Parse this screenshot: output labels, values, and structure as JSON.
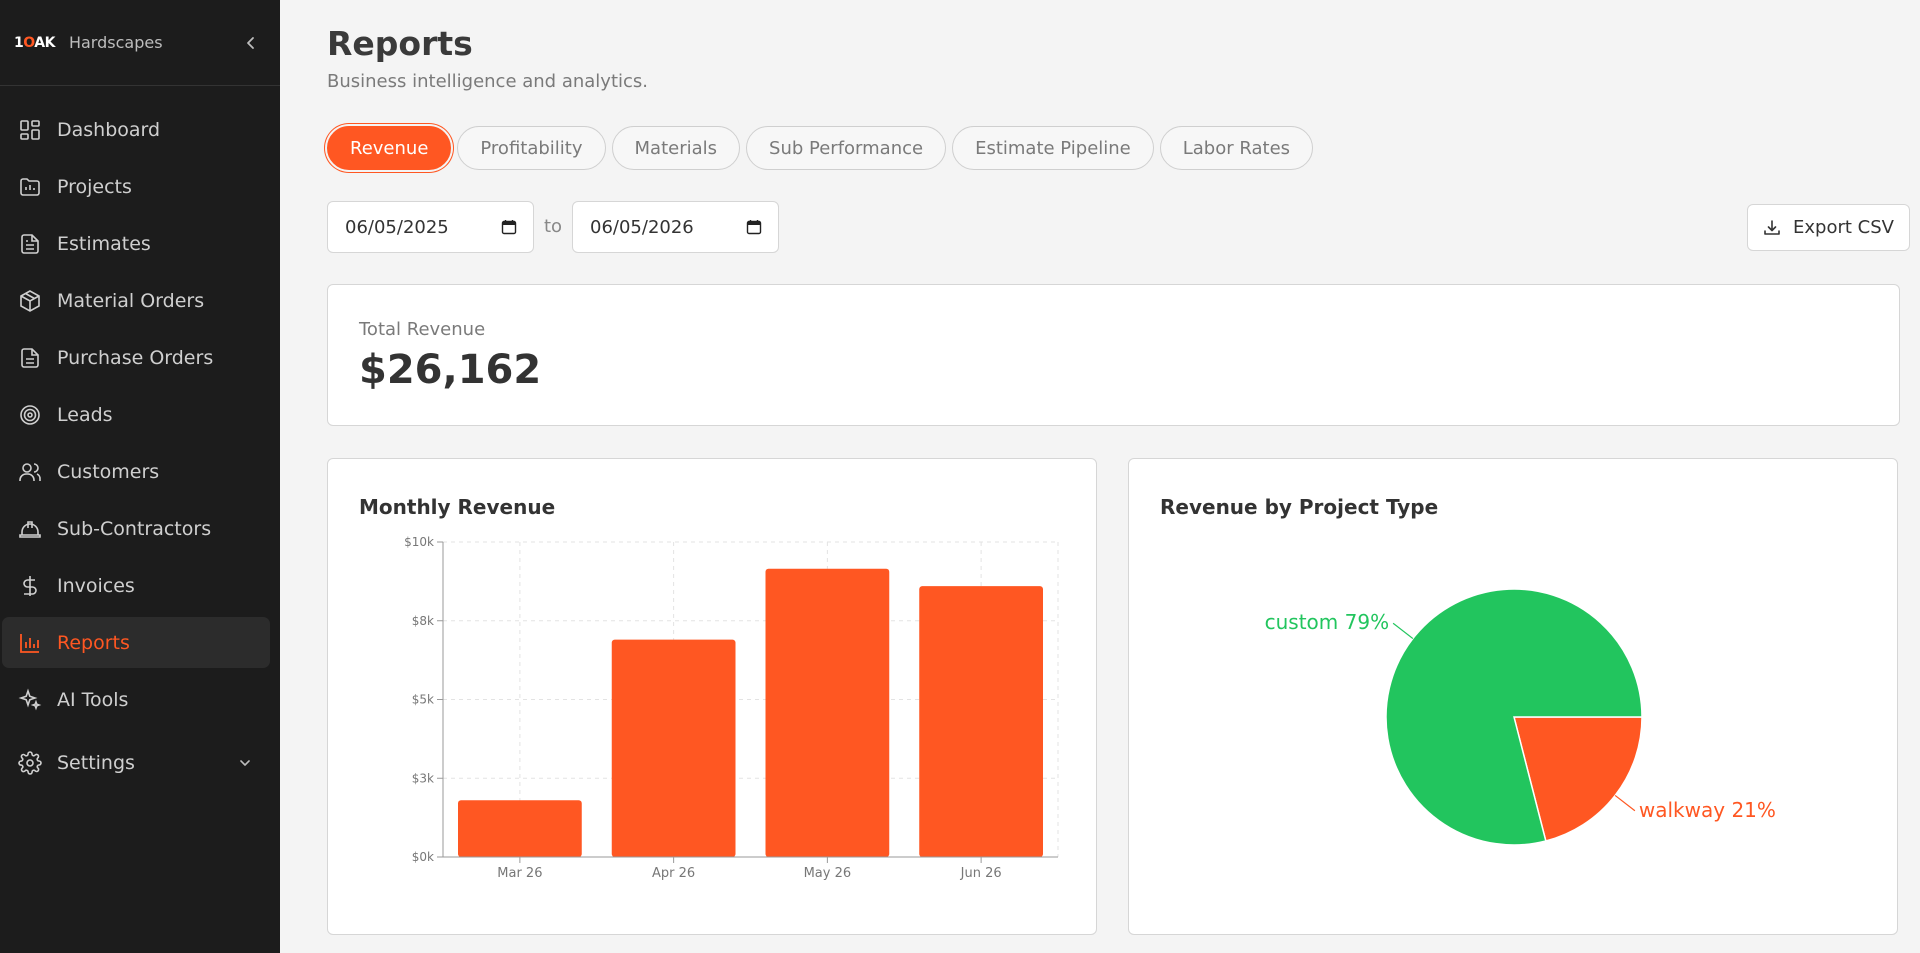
{
  "brand": {
    "logo_prefix": "1",
    "logo_o": "O",
    "logo_suffix": "AK",
    "name": "Hardscapes"
  },
  "sidebar": {
    "items": [
      {
        "label": "Dashboard",
        "icon": "dashboard-icon",
        "active": false
      },
      {
        "label": "Projects",
        "icon": "projects-icon",
        "active": false
      },
      {
        "label": "Estimates",
        "icon": "estimates-icon",
        "active": false
      },
      {
        "label": "Material Orders",
        "icon": "package-icon",
        "active": false
      },
      {
        "label": "Purchase Orders",
        "icon": "document-icon",
        "active": false
      },
      {
        "label": "Leads",
        "icon": "target-icon",
        "active": false
      },
      {
        "label": "Customers",
        "icon": "users-icon",
        "active": false
      },
      {
        "label": "Sub-Contractors",
        "icon": "hard-hat-icon",
        "active": false
      },
      {
        "label": "Invoices",
        "icon": "dollar-icon",
        "active": false
      },
      {
        "label": "Reports",
        "icon": "bar-chart-icon",
        "active": true
      },
      {
        "label": "AI Tools",
        "icon": "sparkles-icon",
        "active": false
      }
    ],
    "settings_label": "Settings"
  },
  "page": {
    "title": "Reports",
    "subtitle": "Business intelligence and analytics."
  },
  "tabs": [
    {
      "label": "Revenue",
      "active": true
    },
    {
      "label": "Profitability",
      "active": false
    },
    {
      "label": "Materials",
      "active": false
    },
    {
      "label": "Sub Performance",
      "active": false
    },
    {
      "label": "Estimate Pipeline",
      "active": false
    },
    {
      "label": "Labor Rates",
      "active": false
    }
  ],
  "filters": {
    "start_date": "06/05/2025",
    "to_label": "to",
    "end_date": "06/05/2026",
    "export_label": "Export CSV"
  },
  "summary": {
    "total_label": "Total Revenue",
    "total_value": "$26,162"
  },
  "colors": {
    "accent": "#ff5722",
    "green": "#22c55e",
    "sidebar_bg": "#1c1c1c"
  },
  "chart_data": [
    {
      "type": "bar",
      "title": "Monthly Revenue",
      "categories": [
        "Mar 26",
        "Apr 26",
        "May 26",
        "Jun 26"
      ],
      "values": [
        1800,
        6900,
        9150,
        8600
      ],
      "ylim": [
        0,
        10000
      ],
      "yticks": [
        0,
        2500,
        5000,
        7500,
        10000
      ],
      "ytick_labels": [
        "$0k",
        "$3k",
        "$5k",
        "$8k",
        "$10k"
      ],
      "grid": true,
      "color": "#ff5722"
    },
    {
      "type": "pie",
      "title": "Revenue by Project Type",
      "slices": [
        {
          "label": "walkway",
          "value": 21,
          "display": "walkway 21%",
          "color": "#ff5722"
        },
        {
          "label": "custom",
          "value": 79,
          "display": "custom 79%",
          "color": "#22c55e"
        }
      ]
    }
  ]
}
